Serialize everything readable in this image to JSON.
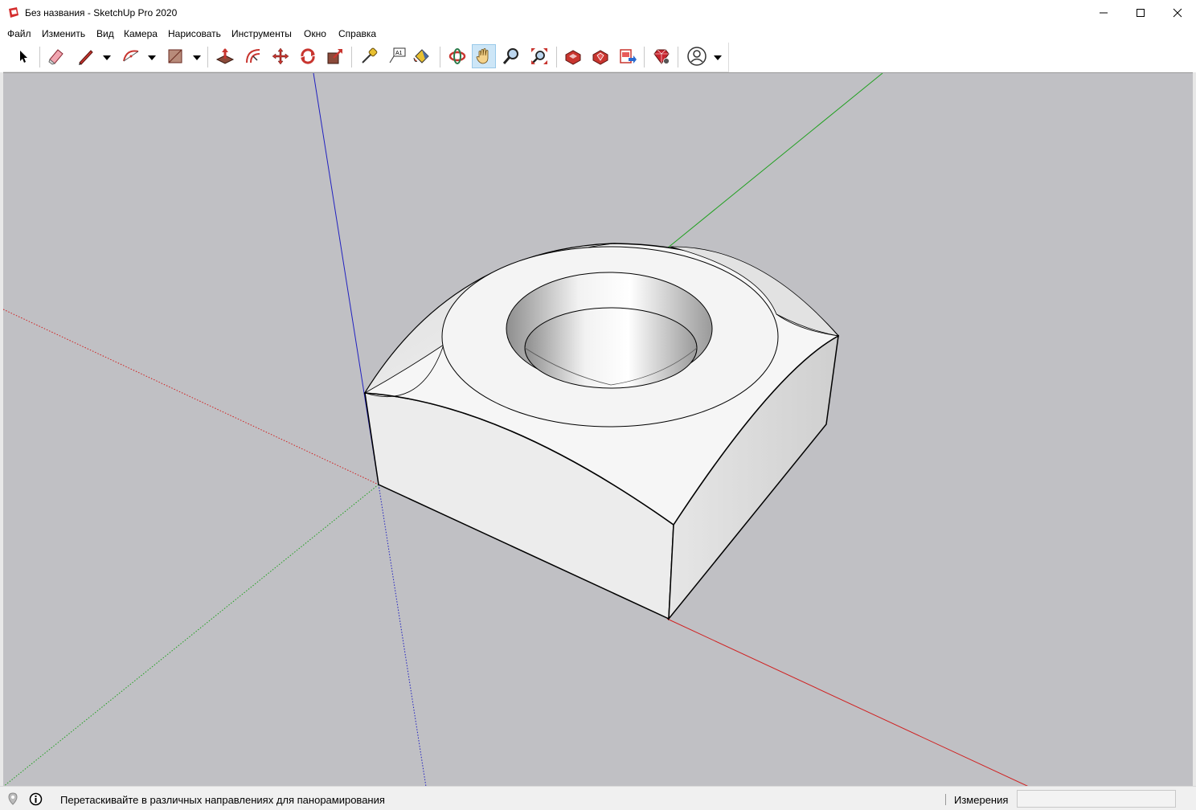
{
  "window": {
    "title": "Без названия - SketchUp Pro 2020",
    "minimize_icon": "minimize-icon",
    "maximize_icon": "maximize-icon",
    "close_icon": "close-icon"
  },
  "menu": {
    "items": [
      "Файл",
      "Изменить",
      "Вид",
      "Камера",
      "Нарисовать",
      "Инструменты",
      "Окно",
      "Справка"
    ]
  },
  "toolbar": {
    "tools": [
      "select-tool",
      "eraser-tool",
      "line-tool",
      "arc-tool",
      "rectangle-tool",
      "push-pull-tool",
      "offset-tool",
      "move-tool",
      "rotate-tool",
      "scale-tool",
      "tape-measure-tool",
      "text-tool",
      "paint-bucket-tool",
      "orbit-tool",
      "pan-tool",
      "zoom-tool",
      "zoom-extents-tool",
      "3d-warehouse",
      "extension-warehouse",
      "layout-send",
      "extension-manager",
      "account"
    ],
    "active_tool": "pan-tool"
  },
  "status": {
    "hint": "Перетаскивайте в различных направлениях для панорамирования",
    "measurements_label": "Измерения",
    "measurements_value": ""
  },
  "colors": {
    "viewport_bg": "#c0c0c4",
    "axis_red": "#d02020",
    "axis_green": "#20a020",
    "axis_blue": "#2020c0",
    "brand_red": "#d42d2d"
  }
}
